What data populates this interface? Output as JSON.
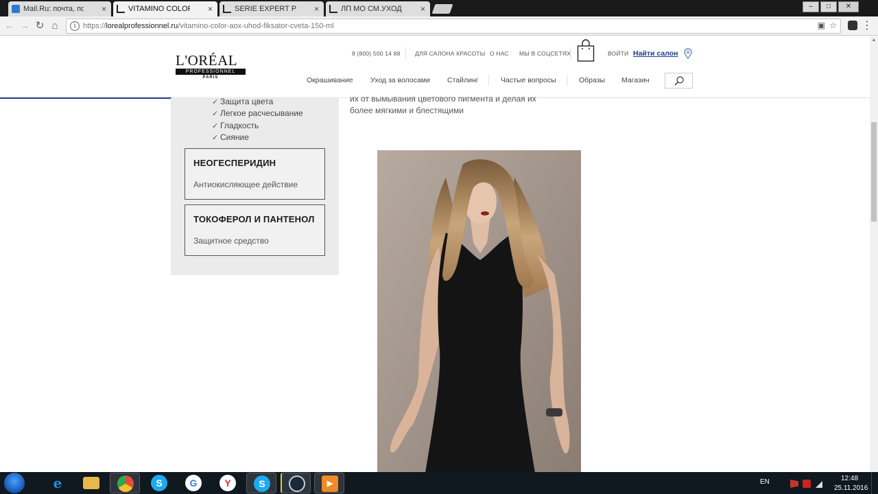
{
  "browser": {
    "tabs": [
      {
        "title": "Mail.Ru: почта, поиск в",
        "favicon_color": "#2b7bd6",
        "active": false
      },
      {
        "title": "VITAMINO COLOR AOX",
        "favicon_color": "#222222",
        "active": true
      },
      {
        "title": "SERIE EXPERT PRO-KERA",
        "favicon_color": "#222222",
        "active": false
      },
      {
        "title": "ЛП МО СМ.УХОД Д/ПЛ",
        "favicon_color": "#222222",
        "active": false
      }
    ],
    "tab_close_glyph": "×",
    "url_scheme": "https://",
    "url_host": "lorealprofessionnel.ru",
    "url_path": "/vitamino-color-aox-uhod-fiksator-cveta-150-ml"
  },
  "site": {
    "logo": {
      "brand": "L'ORÉAL",
      "sub": "PROFESSIONNEL",
      "paris": "PARIS"
    },
    "util_links": {
      "phone": "8 (800) 500 14 88",
      "for_salon": "ДЛЯ САЛОНА КРАСОТЫ",
      "about": "О НАС",
      "social": "МЫ В СОЦСЕТЯХ",
      "login": "ВОЙТИ",
      "find_salon": "Найти салон"
    },
    "nav": [
      "Окрашивание",
      "Уход за волосами",
      "Стайлинг",
      "Частые вопросы",
      "Образы",
      "Магазин"
    ],
    "accent_color": "#233a84"
  },
  "content": {
    "benefits": [
      "Защита цвета",
      "Легкое расчесывание",
      "Гладкость",
      "Сияние"
    ],
    "check_glyph": "✓",
    "ingredients": [
      {
        "name": "НЕОГЕСПЕРИДИН",
        "desc": "Антиокисляющее действие"
      },
      {
        "name": "ТОКОФЕРОЛ И ПАНТЕНОЛ",
        "desc": "Защитное средство"
      }
    ],
    "description_lines": [
      "их от вымывания цветового пигмента и делая их",
      "более мягкими и блестящими"
    ]
  },
  "taskbar": {
    "language": "EN",
    "time": "12:48",
    "date": "25.11.2016",
    "apps": [
      {
        "name": "internet-explorer",
        "glyph": "e",
        "color": "#1f8fe0"
      },
      {
        "name": "file-explorer",
        "glyph": "",
        "color": "#e8b84a"
      },
      {
        "name": "chrome",
        "glyph": "",
        "color": "#e54b3c"
      },
      {
        "name": "skype",
        "glyph": "S",
        "color": "#1eaaf1"
      },
      {
        "name": "google",
        "glyph": "G",
        "color": "#ffffff"
      },
      {
        "name": "yandex-browser",
        "glyph": "Y",
        "color": "#ffffff"
      },
      {
        "name": "skype",
        "glyph": "S",
        "color": "#1eaaf1"
      },
      {
        "name": "steam",
        "glyph": "",
        "color": "#1b2838"
      },
      {
        "name": "media-player",
        "glyph": "▶",
        "color": "#f08a24"
      }
    ]
  }
}
